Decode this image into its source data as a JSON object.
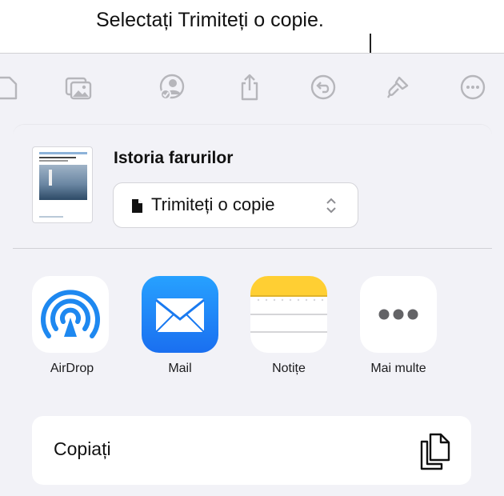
{
  "callout": {
    "text": "Selectați Trimiteți o copie."
  },
  "toolbar": {
    "icons": [
      "document-icon",
      "media-icon",
      "collaborate-icon",
      "share-icon",
      "undo-icon",
      "format-brush-icon",
      "more-icon"
    ]
  },
  "share_sheet": {
    "document_title": "Istoria farurilor",
    "send_option": {
      "label": "Trimiteți o copie"
    },
    "apps": [
      {
        "label": "AirDrop",
        "icon": "airdrop-icon"
      },
      {
        "label": "Mail",
        "icon": "mail-icon"
      },
      {
        "label": "Notițe",
        "icon": "notes-icon"
      },
      {
        "label": "Mai multe",
        "icon": "more-dots-icon"
      }
    ],
    "actions": [
      {
        "label": "Copiați",
        "icon": "copy-icon"
      }
    ]
  },
  "colors": {
    "toolbar_icon": "#b6b6bb",
    "sheet_background": "#f2f2f7",
    "airdrop_blue": "#1e88f0",
    "mail_blue": "#1a8cff",
    "notes_yellow": "#ffcf33"
  }
}
